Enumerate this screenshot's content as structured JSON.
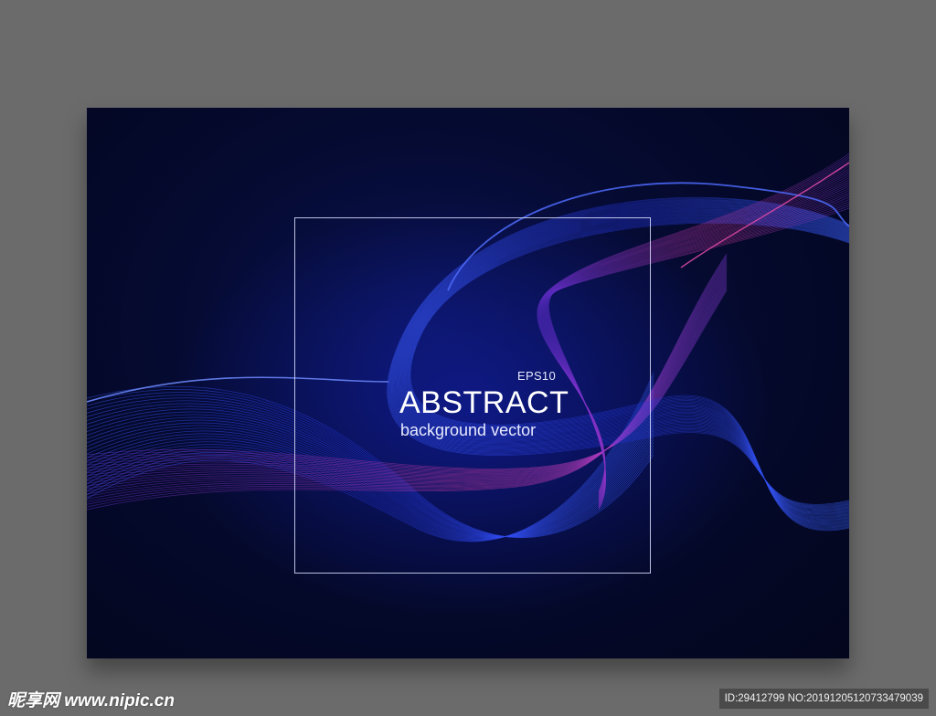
{
  "artwork": {
    "eps_label": "EPS10",
    "title": "ABSTRACT",
    "subtitle": "background vector"
  },
  "watermark": {
    "logo_text": "昵享网 www.nipic.cn",
    "id_text": "ID:29412799 NO:20191205120733479039"
  },
  "colors": {
    "page_background": "#6b6b6b",
    "card_background": "#050a30",
    "wave_blue": "#2a46ff",
    "wave_magenta": "#d0389a",
    "frame": "#dce1ff"
  }
}
